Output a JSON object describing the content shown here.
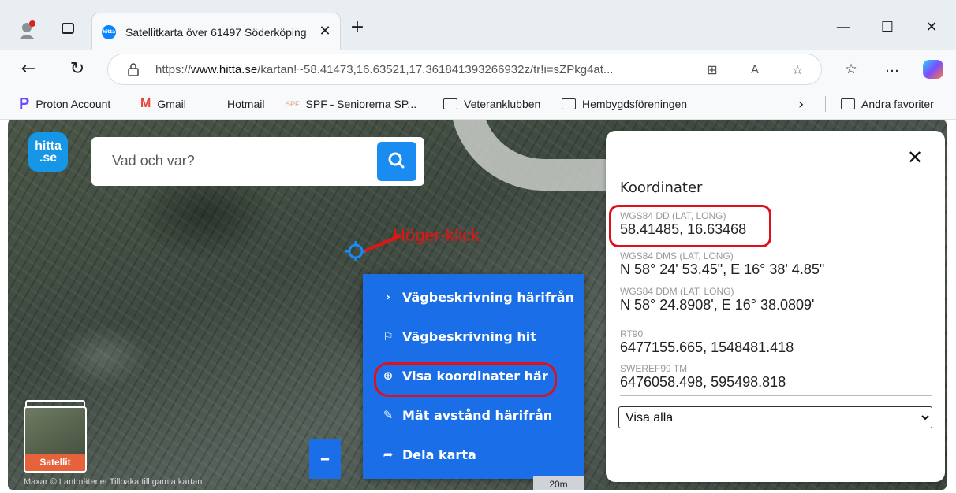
{
  "browser": {
    "tab_title": "Satellitkarta över 61497 Söderköping",
    "tab_close": "✕",
    "new_tab": "+",
    "win_min": "—",
    "win_max": "☐",
    "win_close": "✕",
    "url_prefix": "https://",
    "url_host": "www.hitta.se",
    "url_path": "/kartan!~58.41473,16.63521,17.361841393266932z/tr!i=sZPkg4at...",
    "nav_back": "←",
    "nav_reload": "↻",
    "icons": {
      "apps": "⊞",
      "read_aloud": "A",
      "star": "☆",
      "favorites": "☆",
      "more": "…"
    }
  },
  "bookmarks": [
    {
      "label": "Proton Account",
      "icon": "P"
    },
    {
      "label": "Gmail",
      "icon": "M"
    },
    {
      "label": "Hotmail",
      "icon": "microsoft-icon"
    },
    {
      "label": "SPF - Seniorerna SP...",
      "icon": "SPF"
    },
    {
      "label": "Veteranklubben",
      "icon": "folder-icon"
    },
    {
      "label": "Hembygdsföreningen",
      "icon": "folder-icon"
    },
    {
      "label": "Andra favoriter",
      "icon": "folder-icon"
    }
  ],
  "bookmarks_more": "›",
  "map": {
    "logo": "hitta\n.se",
    "search_placeholder": "Vad och var?",
    "annotation": "Höger-klick",
    "zoom_minus": "–",
    "scale": "20m",
    "attribution": "Maxar © Lantmäteriet  Tillbaka till gamla kartan",
    "layer_label": "Satellit"
  },
  "context_menu": {
    "items": [
      {
        "icon": "›",
        "label": "Vägbeskrivning härifrån"
      },
      {
        "icon": "⚐",
        "label": "Vägbeskrivning hit"
      },
      {
        "icon": "⊕",
        "label": "Visa koordinater här"
      },
      {
        "icon": "✎",
        "label": "Mät avstånd härifrån"
      },
      {
        "icon": "➦",
        "label": "Dela karta"
      }
    ]
  },
  "panel": {
    "close": "✕",
    "title": "Koordinater",
    "coords": [
      {
        "label": "WGS84 DD (LAT, LONG)",
        "value": "58.41485, 16.63468"
      },
      {
        "label": "WGS84 DMS (LAT, LONG)",
        "value": "N 58° 24' 53.45\", E 16° 38' 4.85\""
      },
      {
        "label": "WGS84 DDM (LAT, LONG)",
        "value": "N 58° 24.8908', E 16° 38.0809'"
      },
      {
        "label": "RT90",
        "value": "6477155.665, 1548481.418"
      },
      {
        "label": "SWEREF99 TM",
        "value": "6476058.498, 595498.818"
      }
    ],
    "select_value": "Visa alla"
  },
  "colors": {
    "menu_blue": "#1a6fe8",
    "search_blue": "#1a8bf0",
    "highlight_red": "#e0101a",
    "logo_blue": "#1596e6"
  }
}
